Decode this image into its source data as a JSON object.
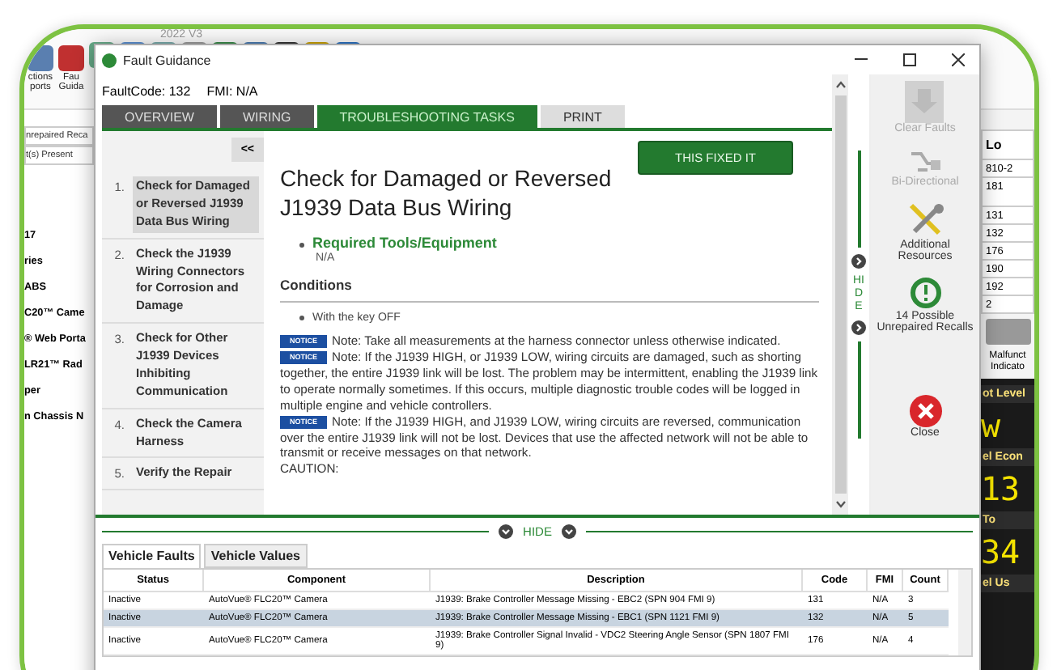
{
  "app": {
    "version": "2022 V3",
    "toolbar": [
      {
        "label": "ctions\nports"
      },
      {
        "label": "Fau\nGuida"
      }
    ],
    "left_fields": [
      "nrepaired Reca",
      "t(s) Present"
    ],
    "left_items": [
      "17",
      "ries",
      "ABS",
      "C20™ Came",
      "® Web Porta",
      "LR21™ Rad",
      "per",
      "n Chassis N"
    ],
    "right_table": {
      "header": "Lo",
      "rows": [
        "810-2",
        "181",
        "131",
        "132",
        "176",
        "190",
        "192",
        "2"
      ]
    },
    "indicator": "Malfunct\nIndicato",
    "gauges": [
      {
        "label": "ot Level",
        "value": "w"
      },
      {
        "label": "el Econ",
        "value": "13"
      },
      {
        "label": "To",
        "value": "34"
      },
      {
        "label": "el Us"
      }
    ]
  },
  "dialog": {
    "title": "Fault Guidance",
    "fault_code": "FaultCode: 132",
    "fmi": "FMI: N/A",
    "tabs": [
      {
        "label": "OVERVIEW",
        "selected": false
      },
      {
        "label": "WIRING",
        "selected": false
      },
      {
        "label": "TROUBLESHOOTING TASKS",
        "selected": true
      },
      {
        "label": "PRINT",
        "selected": false
      }
    ],
    "collapse": "<<",
    "steps": [
      {
        "number": "1.",
        "label": "Check for Damaged or Reversed J1939 Data Bus Wiring",
        "selected": true
      },
      {
        "number": "2.",
        "label": "Check the J1939 Wiring Connectors for Corrosion and Damage",
        "selected": false
      },
      {
        "number": "3.",
        "label": "Check for Other J1939 Devices Inhibiting Communication",
        "selected": false
      },
      {
        "number": "4.",
        "label": "Check the Camera Harness",
        "selected": false
      },
      {
        "number": "5.",
        "label": "Verify the Repair",
        "selected": false
      }
    ],
    "heading": "Check for Damaged or Reversed J1939 Data Bus Wiring",
    "fixed_button": "THIS FIXED IT",
    "tools_title": "Required Tools/Equipment",
    "tools_value": "N/A",
    "conditions_title": "Conditions",
    "conditions": [
      "With the key OFF"
    ],
    "notes": [
      {
        "badge": "NOTICE",
        "text": "Note: Take all measurements at the harness connector unless otherwise indicated."
      },
      {
        "badge": "NOTICE",
        "text": "Note: If the J1939 HIGH, or J1939 LOW, wiring circuits are damaged, such as shorting together, the entire J1939 link will be lost. The problem may be intermittent, enabling the J1939 link to operate normally sometimes. If this occurs, multiple diagnostic trouble codes will be logged in multiple engine and vehicle controllers."
      },
      {
        "badge": "NOTICE",
        "text": "Note: If the J1939 HIGH, and J1939 LOW, wiring circuits are reversed, communication over the entire J1939 link will not be lost. Devices that use the affected network will not be able to transmit or receive messages on that network."
      }
    ],
    "caution": "CAUTION:",
    "side_hide": "HIDE",
    "actions": [
      {
        "kind": "clear",
        "label": "Clear Faults",
        "disabled": true
      },
      {
        "kind": "bidirectional",
        "label": "Bi-Directional",
        "disabled": true
      },
      {
        "kind": "resources",
        "label": "Additional Resources",
        "disabled": false
      },
      {
        "kind": "recalls",
        "label": "14 Possible Unrepaired Recalls",
        "disabled": false
      },
      {
        "kind": "close",
        "label": "Close",
        "disabled": false
      }
    ],
    "bottom": {
      "hide": "HIDE",
      "tabs": [
        {
          "label": "Vehicle Faults",
          "selected": true
        },
        {
          "label": "Vehicle Values",
          "selected": false
        }
      ],
      "columns": [
        "Status",
        "Component",
        "Description",
        "Code",
        "FMI",
        "Count"
      ],
      "rows": [
        {
          "cells": [
            "Inactive",
            "AutoVue® FLC20™ Camera",
            "J1939: Brake Controller Message Missing - EBC2 (SPN 904 FMI 9)",
            "131",
            "N/A",
            "3"
          ],
          "selected": false
        },
        {
          "cells": [
            "Inactive",
            "AutoVue® FLC20™ Camera",
            "J1939: Brake Controller Message Missing - EBC1 (SPN 1121 FMI 9)",
            "132",
            "N/A",
            "5"
          ],
          "selected": true
        },
        {
          "cells": [
            "Inactive",
            "AutoVue® FLC20™ Camera",
            "J1939: Brake Controller Signal Invalid - VDC2 Steering Angle Sensor (SPN 1807 FMI 9)",
            "176",
            "N/A",
            "4"
          ],
          "selected": false
        }
      ]
    }
  }
}
